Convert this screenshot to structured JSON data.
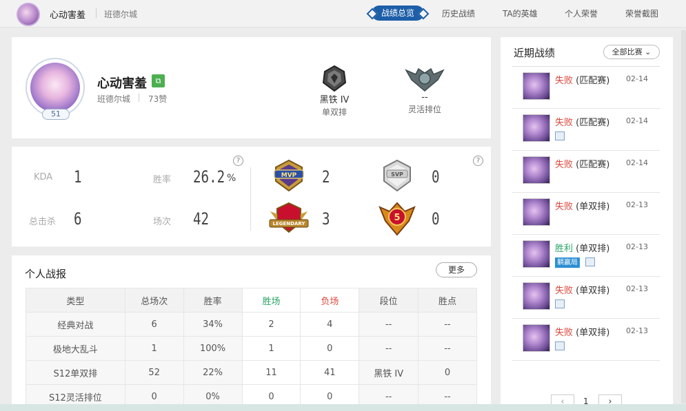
{
  "header": {
    "player_name": "心动害羞",
    "server": "班德尔城",
    "tabs": [
      {
        "label": "战绩总览",
        "active": true
      },
      {
        "label": "历史战绩"
      },
      {
        "label": "TA的英雄"
      },
      {
        "label": "个人荣誉"
      },
      {
        "label": "荣誉截图"
      }
    ]
  },
  "profile": {
    "name": "心动害羞",
    "server": "班德尔城",
    "likes": "73赞",
    "level": "51",
    "ranks": [
      {
        "tier": "黑铁 IV",
        "queue": "单双排"
      },
      {
        "tier": "--",
        "queue": "灵活排位"
      }
    ]
  },
  "stats": {
    "kda_label": "KDA",
    "kda": "1",
    "winrate_label": "胜率",
    "winrate": "26.2",
    "winrate_unit": "%",
    "kills_label": "总击杀",
    "kills": "6",
    "games_label": "场次",
    "games": "42",
    "badges": [
      {
        "name": "MVP",
        "count": "2"
      },
      {
        "name": "SVP",
        "count": "0"
      },
      {
        "name": "LEGENDARY",
        "count": "3"
      },
      {
        "name": "5",
        "count": "0"
      }
    ]
  },
  "report": {
    "title": "个人战报",
    "more_label": "更多",
    "headers": [
      "类型",
      "总场次",
      "胜率",
      "胜场",
      "负场",
      "段位",
      "胜点"
    ],
    "rows": [
      [
        "经典对战",
        "6",
        "34%",
        "2",
        "4",
        "--",
        "--"
      ],
      [
        "极地大乱斗",
        "1",
        "100%",
        "1",
        "0",
        "--",
        "--"
      ],
      [
        "S12单双排",
        "52",
        "22%",
        "11",
        "41",
        "黑铁 IV",
        "0"
      ],
      [
        "S12灵活排位",
        "0",
        "0%",
        "0",
        "0",
        "--",
        "--"
      ]
    ]
  },
  "recent": {
    "title": "近期战绩",
    "filter": "全部比赛",
    "matches": [
      {
        "result": "失败",
        "win": false,
        "mode": "(匹配赛)",
        "date": "02-14",
        "has_image": false,
        "tag": ""
      },
      {
        "result": "失败",
        "win": false,
        "mode": "(匹配赛)",
        "date": "02-14",
        "has_image": true,
        "tag": ""
      },
      {
        "result": "失败",
        "win": false,
        "mode": "(匹配赛)",
        "date": "02-14",
        "has_image": false,
        "tag": ""
      },
      {
        "result": "失败",
        "win": false,
        "mode": "(单双排)",
        "date": "02-13",
        "has_image": false,
        "tag": ""
      },
      {
        "result": "胜利",
        "win": true,
        "mode": "(单双排)",
        "date": "02-13",
        "has_image": true,
        "tag": "躺赢局"
      },
      {
        "result": "失败",
        "win": false,
        "mode": "(单双排)",
        "date": "02-13",
        "has_image": true,
        "tag": ""
      },
      {
        "result": "失败",
        "win": false,
        "mode": "(单双排)",
        "date": "02-13",
        "has_image": true,
        "tag": ""
      }
    ],
    "page": "1"
  },
  "colors": {
    "accent": "#1d5ea8",
    "win": "#2aa564",
    "loss": "#e0463c"
  }
}
